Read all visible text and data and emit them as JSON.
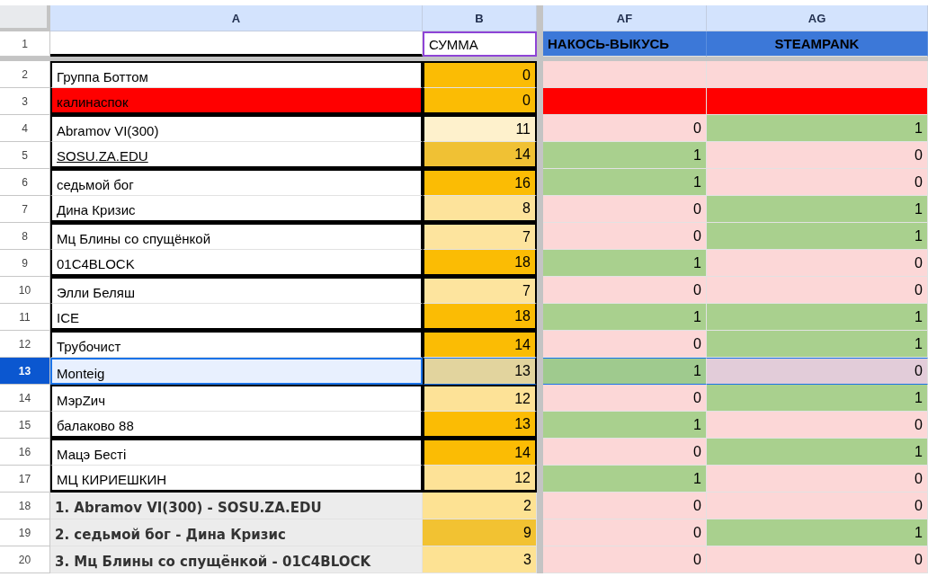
{
  "columns": [
    {
      "letter": "A"
    },
    {
      "letter": "B"
    },
    {
      "letter": "AF"
    },
    {
      "letter": "AG"
    }
  ],
  "title_row": {
    "number": "1",
    "sum_label": "СУММА",
    "sum_outlined": true,
    "teams": [
      "НАКОСЬ-ВЫКУСЬ",
      "STEAMPANK"
    ]
  },
  "pairs": [
    {
      "rows": [
        {
          "number": "2",
          "kind": "team",
          "selected": false,
          "name": "Группа Боттом",
          "sum": "0",
          "color": "#fbbc04",
          "scores": [
            {
              "color": "#fcd7d7"
            },
            {
              "color": "#fcd7d7"
            }
          ]
        },
        {
          "number": "3",
          "kind": "eliminated",
          "selected": false,
          "name": "калинаспок",
          "sum": "0",
          "color": "#fbbc04",
          "scores": [
            {
              "color": "#ff0000"
            },
            {
              "color": "#ff0000"
            }
          ]
        }
      ]
    },
    {
      "rows": [
        {
          "number": "4",
          "kind": "team",
          "selected": false,
          "name": "Abramov VI(300)",
          "sum": "11",
          "color": "#fef1cc",
          "scores": [
            {
              "value": "0",
              "color": "#fcd7d7"
            },
            {
              "value": "1",
              "color": "#a9d08e"
            }
          ]
        },
        {
          "number": "5",
          "kind": "team",
          "selected": false,
          "link": true,
          "name": "SOSU.ZA.EDU",
          "sum": "14",
          "color": "#f0c134",
          "scores": [
            {
              "value": "1",
              "color": "#a9d08e"
            },
            {
              "value": "0",
              "color": "#fcd7d7"
            }
          ]
        }
      ]
    },
    {
      "rows": [
        {
          "number": "6",
          "kind": "team",
          "selected": false,
          "name": "седьмой бог",
          "sum": "16",
          "color": "#fbbc04",
          "scores": [
            {
              "value": "1",
              "color": "#a9d08e"
            },
            {
              "value": "0",
              "color": "#fcd7d7"
            }
          ]
        },
        {
          "number": "7",
          "kind": "team",
          "selected": false,
          "name": "Дина Кризис",
          "sum": "8",
          "color": "#fde39b",
          "scores": [
            {
              "value": "0",
              "color": "#fcd7d7"
            },
            {
              "value": "1",
              "color": "#a9d08e"
            }
          ]
        }
      ]
    },
    {
      "rows": [
        {
          "number": "8",
          "kind": "team",
          "selected": false,
          "name": "Мц Блины со спущёнкой",
          "sum": "7",
          "color": "#fde49e",
          "scores": [
            {
              "value": "0",
              "color": "#fcd7d7"
            },
            {
              "value": "1",
              "color": "#a9d08e"
            }
          ]
        },
        {
          "number": "9",
          "kind": "team",
          "selected": false,
          "name": "01C4BLOCK",
          "sum": "18",
          "color": "#fbbc04",
          "scores": [
            {
              "value": "1",
              "color": "#a9d08e"
            },
            {
              "value": "0",
              "color": "#fcd7d7"
            }
          ]
        }
      ]
    },
    {
      "rows": [
        {
          "number": "10",
          "kind": "team",
          "selected": false,
          "name": "Элли Беляш",
          "sum": "7",
          "color": "#fde49e",
          "scores": [
            {
              "value": "0",
              "color": "#fcd7d7"
            },
            {
              "value": "0",
              "color": "#fcd7d7"
            }
          ]
        },
        {
          "number": "11",
          "kind": "team",
          "selected": false,
          "name": "ICE",
          "sum": "18",
          "color": "#fbbc04",
          "scores": [
            {
              "value": "1",
              "color": "#a9d08e"
            },
            {
              "value": "1",
              "color": "#a9d08e"
            }
          ]
        }
      ]
    },
    {
      "rows": [
        {
          "number": "12",
          "kind": "team",
          "selected": false,
          "name": "Трубочист",
          "sum": "14",
          "color": "#fbbc04",
          "scores": [
            {
              "value": "0",
              "color": "#fcd7d7"
            },
            {
              "value": "1",
              "color": "#a9d08e"
            }
          ]
        },
        {
          "number": "13",
          "kind": "team",
          "selected": true,
          "name": "Monteig",
          "sum": "13",
          "color": "#e2d49e",
          "scores": [
            {
              "value": "1",
              "color": "#9fca8e"
            },
            {
              "value": "0",
              "color": "#e2ccd9"
            }
          ]
        }
      ]
    },
    {
      "rows": [
        {
          "number": "14",
          "kind": "team",
          "selected": false,
          "name": "МэрZич",
          "sum": "12",
          "color": "#fde297",
          "scores": [
            {
              "value": "0",
              "color": "#fcd7d7"
            },
            {
              "value": "1",
              "color": "#a9d08e"
            }
          ]
        },
        {
          "number": "15",
          "kind": "team",
          "selected": false,
          "name": "балаково 88",
          "sum": "13",
          "color": "#fbbc04",
          "scores": [
            {
              "value": "1",
              "color": "#a9d08e"
            },
            {
              "value": "0",
              "color": "#fcd7d7"
            }
          ]
        }
      ]
    },
    {
      "rows": [
        {
          "number": "16",
          "kind": "team",
          "selected": false,
          "name": "Мацэ Бесті",
          "sum": "14",
          "color": "#fbbc04",
          "scores": [
            {
              "value": "0",
              "color": "#fcd7d7"
            },
            {
              "value": "1",
              "color": "#a9d08e"
            }
          ]
        },
        {
          "number": "17",
          "kind": "team",
          "selected": false,
          "name": "МЦ КИРИЕШКИН",
          "sum": "12",
          "color": "#fde297",
          "scores": [
            {
              "value": "1",
              "color": "#a9d08e"
            },
            {
              "value": "0",
              "color": "#fcd7d7"
            }
          ]
        }
      ]
    }
  ],
  "summary_rows": [
    {
      "number": "18",
      "selected": false,
      "name": "1. Abramov VI(300) - SOSU.ZA.EDU",
      "sum": "2",
      "color": "#fde293",
      "scores": [
        {
          "value": "0",
          "color": "#fcd7d7"
        },
        {
          "value": "0",
          "color": "#fcd7d7"
        }
      ]
    },
    {
      "number": "19",
      "selected": false,
      "name": "2. седьмой бог - Дина Кризис",
      "sum": "9",
      "color": "#f2c232",
      "scores": [
        {
          "value": "0",
          "color": "#fcd7d7"
        },
        {
          "value": "1",
          "color": "#a9d08e"
        }
      ]
    },
    {
      "number": "20",
      "selected": false,
      "name": "3. Мц Блины со спущёнкой - 01C4BLOCK",
      "sum": "3",
      "color": "#fde293",
      "scores": [
        {
          "value": "0",
          "color": "#fcd7d7"
        },
        {
          "value": "0",
          "color": "#fcd7d7"
        }
      ]
    }
  ]
}
